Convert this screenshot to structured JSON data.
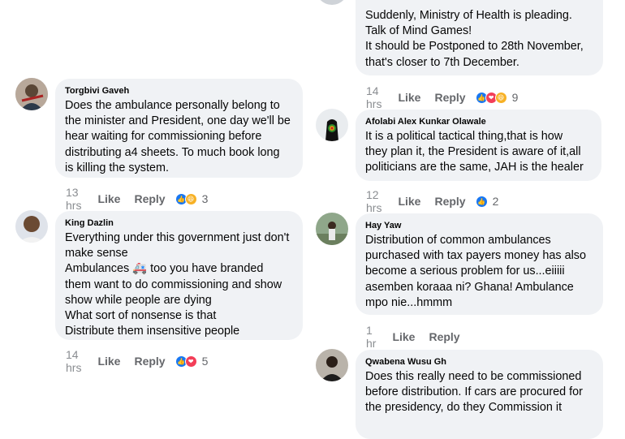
{
  "actions": {
    "like": "Like",
    "reply": "Reply"
  },
  "comments": [
    {
      "author": "Torgbivi Gaveh",
      "text": "Does the ambulance personally belong to\nthe minister and President, one day we'll be\nhear waiting for commissioning before\ndistributing a4 sheets. To much book long\nis killing the system.",
      "time": "13 hrs",
      "reactions": [
        "like-icon",
        "haha-icon"
      ],
      "reaction_count": "3"
    },
    {
      "author": "King Dazlin",
      "text": "Everything under this government just don't\nmake sense\nAmbulances 🚑 too you have branded\nthem want to do commissioning and show\nshow while people are dying\nWhat sort of nonsense is that\nDistribute them insensitive people",
      "time": "14 hrs",
      "reactions": [
        "like-icon",
        "love-icon"
      ],
      "reaction_count": "5"
    },
    {
      "author": "",
      "text": "Suddenly, Ministry of Health is pleading.\nTalk of Mind Games!\nIt should be Postponed to 28th November,\nthat's closer to 7th December.",
      "time": "14 hrs",
      "reactions": [
        "like-icon",
        "love-icon",
        "haha-icon"
      ],
      "reaction_count": "9"
    },
    {
      "author": "Afolabi Alex Kunkar Olawale",
      "text": "It is a political tactical thing,that is how\nthey plan it, the President is aware of it,all\npoliticians are the same, JAH is the healer",
      "time": "12 hrs",
      "reactions": [
        "like-icon"
      ],
      "reaction_count": "2"
    },
    {
      "author": "Hay Yaw",
      "text": "Distribution of common ambulances\npurchased with tax payers money has also\nbecome a serious problem for us...eiiiii\nasemben koraaa ni? Ghana! Ambulance\nmpo nie...hmmm",
      "time": "1 hr",
      "reactions": [],
      "reaction_count": ""
    },
    {
      "author": "Qwabena Wusu Gh",
      "text": "Does this really need to be commissioned\nbefore distribution. If cars are procured for\nthe presidency, do they Commission it",
      "time": "",
      "reactions": [],
      "reaction_count": ""
    }
  ]
}
